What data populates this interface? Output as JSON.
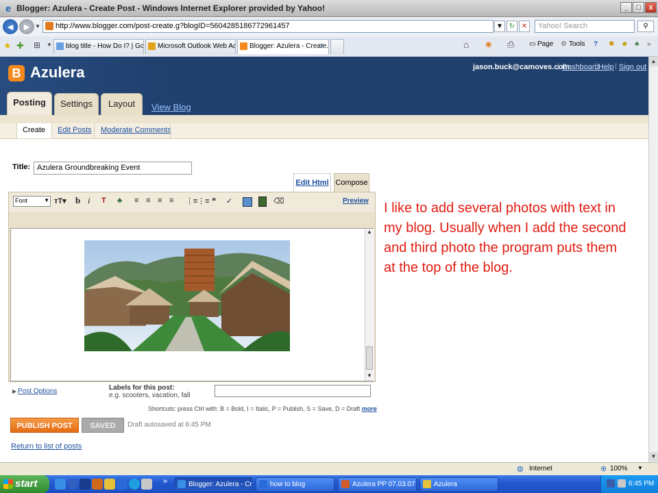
{
  "window": {
    "title": "Blogger: Azulera - Create Post - Windows Internet Explorer provided by Yahoo!",
    "minimize": "_",
    "maximize": "□",
    "close": "x"
  },
  "browser": {
    "url": "http://www.blogger.com/post-create.g?blogID=5604285186772961457",
    "search_placeholder": "Yahoo! Search",
    "tabs": [
      {
        "label": "blog title - How Do I? | Googl..."
      },
      {
        "label": "Microsoft Outlook Web Access"
      },
      {
        "label": "Blogger: Azulera - Create...",
        "active": true
      }
    ],
    "commands": {
      "page": "Page",
      "tools": "Tools"
    }
  },
  "blogger": {
    "logo_letter": "B",
    "blog_name": "Azulera",
    "user_email": "jason.buck@camoves.com",
    "header_links": [
      "Dashboard",
      "Help",
      "Sign out"
    ],
    "main_tabs": [
      "Posting",
      "Settings",
      "Layout"
    ],
    "view_blog": "View Blog",
    "sub_tabs": [
      "Create",
      "Edit Posts",
      "Moderate Comments"
    ]
  },
  "post": {
    "title_label": "Title:",
    "title_value": "Azulera Groundbreaking Event",
    "mode_tabs": [
      "Edit Html",
      "Compose"
    ],
    "font_select": "Font",
    "preview": "Preview",
    "post_options": "Post Options",
    "labels_heading": "Labels for this post:",
    "labels_example": "e.g. scooters, vacation, fall",
    "shortcuts": "Shortcuts: press Ctrl with: B = Bold, I = Italic, P = Publish, S = Save, D = Draft",
    "shortcuts_more": "more",
    "publish_button": "PUBLISH POST",
    "saved_button": "SAVED",
    "autosave_status": "Draft autosaved at 6:45 PM",
    "return_link": "Return to list of posts"
  },
  "annotation": "I like to add several photos with text in my blog. Usually when I add the second and third photo the program puts them at the top of the blog.",
  "statusbar": {
    "zone": "Internet",
    "zoom": "100%"
  },
  "taskbar": {
    "start": "start",
    "tasks": [
      {
        "label": "Blogger: Azulera - Cr...",
        "active": true
      },
      {
        "label": "how to blog"
      },
      {
        "label": "Azulera PP 07.03.07"
      },
      {
        "label": "Azulera"
      }
    ],
    "clock": "6:45 PM"
  },
  "colors": {
    "blogger_header": "#1f3f6c",
    "blogger_orange": "#f48a1e",
    "publish_orange": "#e46c12",
    "annotation_red": "#e01b10",
    "link_blue": "#1a4e9e"
  }
}
